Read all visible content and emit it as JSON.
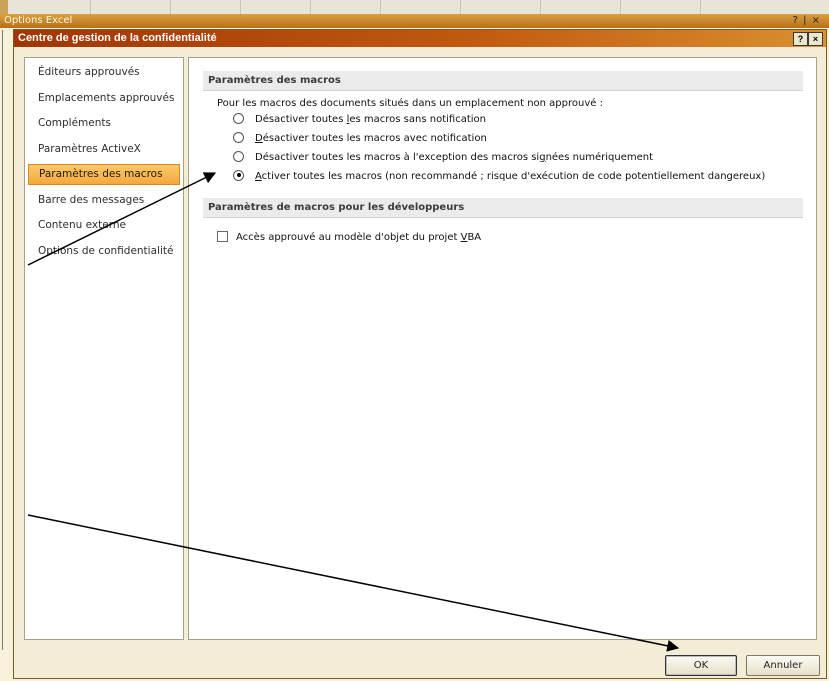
{
  "outer_window": {
    "title": "Options Excel",
    "buttons": "? | ×"
  },
  "dialog": {
    "title": "Centre de gestion de la confidentialité",
    "help_button": "?",
    "close_button": "×"
  },
  "sidebar": {
    "items": [
      {
        "label": "Éditeurs approuvés"
      },
      {
        "label": "Emplacements approuvés"
      },
      {
        "label": "Compléments"
      },
      {
        "label": "Paramètres ActiveX"
      },
      {
        "label": "Paramètres des macros",
        "selected": true
      },
      {
        "label": "Barre des messages"
      },
      {
        "label": "Contenu externe"
      },
      {
        "label": "Options de confidentialité"
      }
    ]
  },
  "content": {
    "macro_section": {
      "header": "Paramètres des macros",
      "description": "Pour les macros des documents situés dans un emplacement non approuvé :",
      "options": [
        {
          "label_pre": "Désactiver toutes ",
          "label_key": "l",
          "label_post": "es macros sans notification",
          "selected": false
        },
        {
          "label_pre": "",
          "label_key": "D",
          "label_post": "ésactiver toutes les macros avec notification",
          "selected": false
        },
        {
          "label_pre": "Désactiver toutes les macros à l'exception des macros si",
          "label_key": "g",
          "label_post": "nées numériquement",
          "selected": false
        },
        {
          "label_pre": "",
          "label_key": "A",
          "label_post": "ctiver toutes les macros (non recommandé ; risque d'exécution de code potentiellement dangereux)",
          "selected": true
        }
      ]
    },
    "developer_section": {
      "header": "Paramètres de macros pour les développeurs",
      "checkbox": {
        "label_pre": "Accès approuvé au modèle d'objet du projet ",
        "label_key": "V",
        "label_post": "BA",
        "checked": false
      }
    }
  },
  "footer": {
    "ok_label": "OK",
    "cancel_label": "Annuler"
  },
  "annotations": {
    "arrow_color": "#000000",
    "arrow_count": 2
  },
  "colors": {
    "titlebar_start": "#a23505",
    "titlebar_end": "#d9902e",
    "selected_item": "#f4a83c",
    "dialog_bg": "#f2edd4"
  }
}
